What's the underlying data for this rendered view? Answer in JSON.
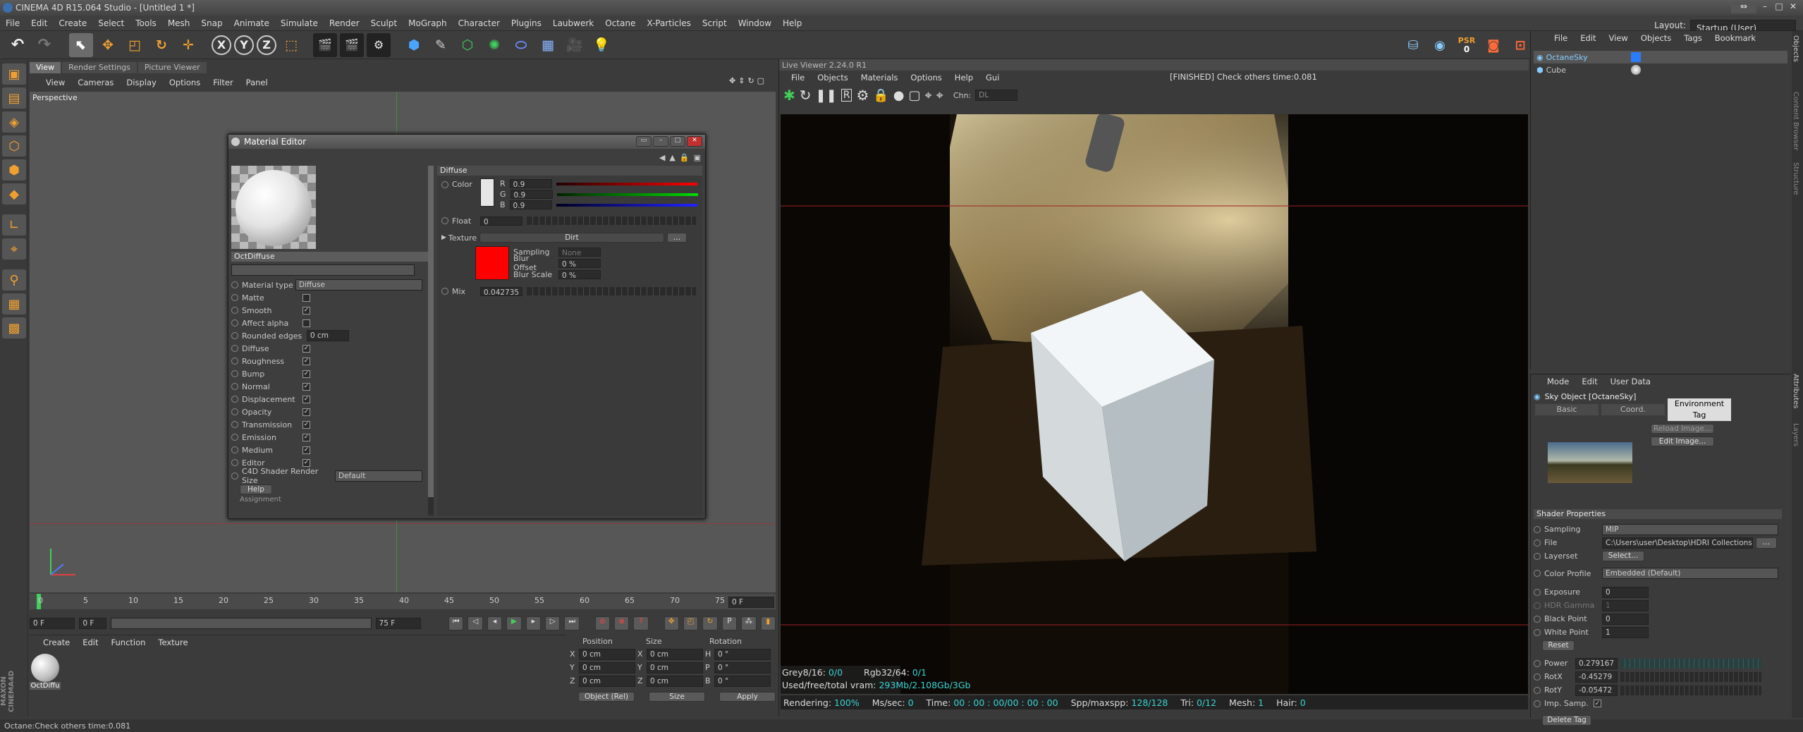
{
  "app": {
    "title": "CINEMA 4D R15.064 Studio - [Untitled 1 *]",
    "layout_label": "Layout:",
    "layout_value": "Startup (User)"
  },
  "menu": [
    "File",
    "Edit",
    "Create",
    "Select",
    "Tools",
    "Mesh",
    "Snap",
    "Animate",
    "Simulate",
    "Render",
    "Sculpt",
    "MoGraph",
    "Character",
    "Plugins",
    "Laubwerk",
    "Octane",
    "X-Particles",
    "Script",
    "Window",
    "Help"
  ],
  "toolbar": {
    "axis_x": "X",
    "axis_y": "Y",
    "axis_z": "Z",
    "psr_label": "PSR",
    "psr_value": "0"
  },
  "viewport": {
    "tabs": [
      "View",
      "Render Settings",
      "Picture Viewer"
    ],
    "menu": [
      "View",
      "Cameras",
      "Display",
      "Options",
      "Filter",
      "Panel"
    ],
    "label": "Perspective"
  },
  "timeline": {
    "ticks": [
      "0",
      "5",
      "10",
      "15",
      "20",
      "25",
      "30",
      "35",
      "40",
      "45",
      "50",
      "55",
      "60",
      "65",
      "70",
      "75"
    ],
    "frame_end": "0 F",
    "start": "0 F",
    "current": "0 F",
    "range_start": "0 F",
    "range_end": "75 F",
    "max": "75 F"
  },
  "material_mgr": {
    "menu": [
      "Create",
      "Edit",
      "Function",
      "Texture"
    ],
    "item_label": "OctDiffu"
  },
  "coords": {
    "headers": [
      "Position",
      "Size",
      "Rotation"
    ],
    "rows": [
      {
        "axis": "X",
        "pos": "0 cm",
        "size": "0 cm",
        "rot_label": "H",
        "rot": "0 °"
      },
      {
        "axis": "Y",
        "pos": "0 cm",
        "size": "0 cm",
        "rot_label": "P",
        "rot": "0 °"
      },
      {
        "axis": "Z",
        "pos": "0 cm",
        "size": "0 cm",
        "rot_label": "B",
        "rot": "0 °"
      }
    ],
    "mode": "Object (Rel)",
    "size_mode": "Size",
    "apply": "Apply"
  },
  "status": {
    "text": "Octane:Check others time:0.081"
  },
  "material_editor": {
    "title": "Material Editor",
    "name": "OctDiffuse",
    "material_type_label": "Material type",
    "material_type": "Diffuse",
    "options": [
      {
        "label": "Matte",
        "checked": ""
      },
      {
        "label": "Smooth",
        "checked": "✓"
      },
      {
        "label": "Affect alpha",
        "checked": ""
      },
      {
        "label": "Diffuse",
        "checked": "✓"
      },
      {
        "label": "Roughness",
        "checked": "✓"
      },
      {
        "label": "Bump",
        "checked": "✓"
      },
      {
        "label": "Normal",
        "checked": "✓"
      },
      {
        "label": "Displacement",
        "checked": "✓"
      },
      {
        "label": "Opacity",
        "checked": "✓"
      },
      {
        "label": "Transmission",
        "checked": "✓"
      },
      {
        "label": "Emission",
        "checked": "✓"
      },
      {
        "label": "Medium",
        "checked": "✓"
      },
      {
        "label": "Editor",
        "checked": "✓"
      }
    ],
    "rounded_edges_label": "Rounded edges",
    "rounded_edges": "0 cm",
    "shader_size_label": "C4D Shader Render Size",
    "shader_size": "Default",
    "help": "Help",
    "assignment": "Assignment",
    "section": "Diffuse",
    "color_label": "Color",
    "r": "0.9",
    "g": "0.9",
    "b": "0.9",
    "r_label": "R",
    "g_label": "G",
    "b_label": "B",
    "float_label": "Float",
    "float_value": "0",
    "texture_label": "Texture",
    "texture_value": "Dirt",
    "sampling_label": "Sampling",
    "sampling_value": "None",
    "blur_offset_label": "Blur Offset",
    "blur_offset": "0 %",
    "blur_scale_label": "Blur Scale",
    "blur_scale": "0 %",
    "mix_label": "Mix",
    "mix_value": "0.042735"
  },
  "live_viewer": {
    "title": "Live Viewer 2.24.0 R1",
    "menu": [
      "File",
      "Objects",
      "Materials",
      "Options",
      "Help",
      "Gui"
    ],
    "status": "[FINISHED] Check others time:0.081",
    "channel_label": "Chn:",
    "channel_value": "DL",
    "info1_a": "Grey8/16:",
    "info1_a_v": "0/0",
    "info1_b": "Rgb32/64:",
    "info1_b_v": "0/1",
    "info2": "Used/free/total vram:",
    "info2_v": "293Mb/2.108Gb/3Gb",
    "bottom": {
      "rendering": "Rendering:",
      "rendering_v": "100%",
      "ms": "Ms/sec:",
      "ms_v": "0",
      "time": "Time:",
      "time_v": "00 : 00 : 00/00 : 00 : 00",
      "spp": "Spp/maxspp:",
      "spp_v": "128/128",
      "tri": "Tri:",
      "tri_v": "0/12",
      "mesh": "Mesh:",
      "mesh_v": "1",
      "hair": "Hair:",
      "hair_v": "0"
    }
  },
  "objects": {
    "menu": [
      "File",
      "Edit",
      "View",
      "Objects",
      "Tags",
      "Bookmark"
    ],
    "items": [
      "OctaneSky",
      "Cube"
    ]
  },
  "attributes": {
    "menu": [
      "Mode",
      "Edit",
      "User Data"
    ],
    "object_title": "Sky Object [OctaneSky]",
    "tabs": [
      "Basic",
      "Coord.",
      "Environment Tag"
    ],
    "reload": "Reload Image...",
    "edit": "Edit Image...",
    "shader_props": "Shader Properties",
    "sampling_label": "Sampling",
    "sampling": "MIP",
    "file_label": "File",
    "file": "C:\\Users\\user\\Desktop\\HDRI Collections",
    "layerset_label": "Layerset",
    "layerset": "Select...",
    "color_profile_label": "Color Profile",
    "color_profile": "Embedded (Default)",
    "exposure_label": "Exposure",
    "exposure": "0",
    "hdr_gamma_label": "HDR Gamma",
    "hdr_gamma": "1",
    "black_point_label": "Black Point",
    "black_point": "0",
    "white_point_label": "White Point",
    "white_point": "1",
    "reset": "Reset",
    "power_label": "Power",
    "power": "0.279167",
    "rotx_label": "RotX",
    "rotx": "-0.45279",
    "roty_label": "RotY",
    "roty": "-0.05472",
    "imp_samp_label": "Imp. Samp.",
    "delete_tag": "Delete Tag"
  },
  "side_tabs": [
    "Objects",
    "Content Browser",
    "Structure",
    "Attributes",
    "Layers"
  ],
  "colors": {
    "accent": "#39d4d4",
    "red": "#ff0000",
    "panel": "#3b3b3b"
  }
}
